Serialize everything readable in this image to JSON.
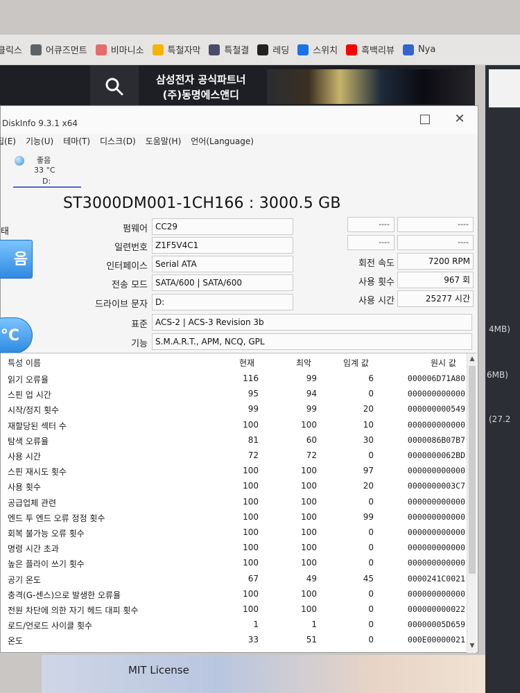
{
  "browser": {
    "bookmarks": [
      {
        "label": "클릭스",
        "color": "#7a7a7a"
      },
      {
        "label": "어큐즈먼트",
        "color": "#5f6368"
      },
      {
        "label": "비마니소",
        "color": "#e36d6d"
      },
      {
        "label": "특철자막",
        "color": "#f4b400"
      },
      {
        "label": "특철결",
        "color": "#4a4a6a"
      },
      {
        "label": "레딩",
        "color": "#222222"
      },
      {
        "label": "스위치",
        "color": "#1a73e8"
      },
      {
        "label": "흑백리뷰",
        "color": "#ff0000"
      },
      {
        "label": "Nya",
        "color": "#3366cc"
      }
    ]
  },
  "site": {
    "title_line1": "삼성전자 공식파트너",
    "title_line2": "(주)동명에스앤디"
  },
  "background_text": {
    "right1": "4MB)",
    "right2": "6MB)",
    "right3": "(27.2",
    "bottom": "MIT License"
  },
  "window": {
    "title": "DiskInfo 9.3.1 x64",
    "minimize": "—",
    "maximize": "□",
    "close": "✕",
    "menu": [
      "집(E)",
      "기능(U)",
      "테마(T)",
      "디스크(D)",
      "도움말(H)",
      "언어(Language)"
    ]
  },
  "disk_tab": {
    "status": "좋음",
    "temp": "33 °C",
    "drive": "D:"
  },
  "drive": {
    "model": "ST3000DM001-1CH166 : 3000.5 GB",
    "health_label": "태",
    "health_text": "음",
    "temp_text": "°C",
    "firmware_label": "펌웨어",
    "firmware": "CC29",
    "serial_label": "일련번호",
    "serial": "Z1F5V4C1",
    "interface_label": "인터페이스",
    "interface": "Serial ATA",
    "transfer_label": "전송 모드",
    "transfer": "SATA/600 | SATA/600",
    "letter_label": "드라이브 문자",
    "letter": "D:",
    "standard_label": "표준",
    "standard": "ACS-2 | ACS-3 Revision 3b",
    "features_label": "기능",
    "features": "S.M.A.R.T., APM, NCQ, GPL",
    "dash1": "----",
    "dash2": "----",
    "dash3": "----",
    "dash4": "----",
    "rotation_label": "회전 속도",
    "rotation": "7200 RPM",
    "power_count_label": "사용 횟수",
    "power_count": "967 회",
    "power_hours_label": "사용 시간",
    "power_hours": "25277 시간"
  },
  "smart": {
    "headers": {
      "name": "특성 이름",
      "current": "현재",
      "worst": "최악",
      "threshold": "임계 값",
      "raw": "원시 값"
    },
    "rows": [
      {
        "name": "읽기 오류율",
        "current": "116",
        "worst": "99",
        "threshold": "6",
        "raw": "000006D71A80"
      },
      {
        "name": "스핀 업 시간",
        "current": "95",
        "worst": "94",
        "threshold": "0",
        "raw": "000000000000"
      },
      {
        "name": "시작/정지 횟수",
        "current": "99",
        "worst": "99",
        "threshold": "20",
        "raw": "000000000549"
      },
      {
        "name": "재할당된 섹터 수",
        "current": "100",
        "worst": "100",
        "threshold": "10",
        "raw": "000000000000"
      },
      {
        "name": "탐색 오류율",
        "current": "81",
        "worst": "60",
        "threshold": "30",
        "raw": "0000086B07B7"
      },
      {
        "name": "사용 시간",
        "current": "72",
        "worst": "72",
        "threshold": "0",
        "raw": "0000000062BD"
      },
      {
        "name": "스핀 재시도 횟수",
        "current": "100",
        "worst": "100",
        "threshold": "97",
        "raw": "000000000000"
      },
      {
        "name": "사용 횟수",
        "current": "100",
        "worst": "100",
        "threshold": "20",
        "raw": "0000000003C7"
      },
      {
        "name": "공급업체 관련",
        "current": "100",
        "worst": "100",
        "threshold": "0",
        "raw": "000000000000"
      },
      {
        "name": "엔드 투 엔드 오류 정정 횟수",
        "current": "100",
        "worst": "100",
        "threshold": "99",
        "raw": "000000000000"
      },
      {
        "name": "회복 불가능 오류 횟수",
        "current": "100",
        "worst": "100",
        "threshold": "0",
        "raw": "000000000000"
      },
      {
        "name": "명령 시간 초과",
        "current": "100",
        "worst": "100",
        "threshold": "0",
        "raw": "000000000000"
      },
      {
        "name": "높은 플라이 쓰기 횟수",
        "current": "100",
        "worst": "100",
        "threshold": "0",
        "raw": "000000000000"
      },
      {
        "name": "공기 온도",
        "current": "67",
        "worst": "49",
        "threshold": "45",
        "raw": "0000241C0021"
      },
      {
        "name": "충격(G-센스)으로 발생한 오류율",
        "current": "100",
        "worst": "100",
        "threshold": "0",
        "raw": "000000000000"
      },
      {
        "name": "전원 차단에 의한 자기 헤드 대피 횟수",
        "current": "100",
        "worst": "100",
        "threshold": "0",
        "raw": "000000000022"
      },
      {
        "name": "로드/언로드 사이클 횟수",
        "current": "1",
        "worst": "1",
        "threshold": "0",
        "raw": "00000005D659"
      },
      {
        "name": "온도",
        "current": "33",
        "worst": "51",
        "threshold": "0",
        "raw": "000E00000021"
      }
    ]
  }
}
